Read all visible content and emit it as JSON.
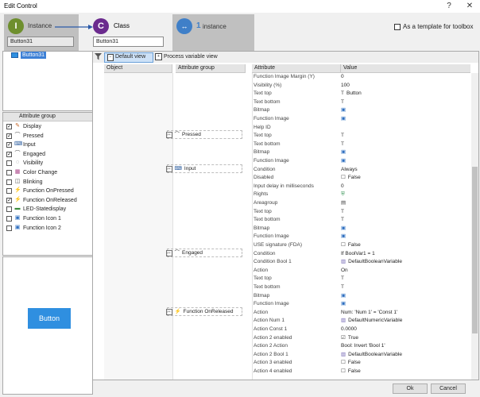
{
  "window": {
    "title": "Edit Control",
    "help": "?",
    "close": "✕"
  },
  "header": {
    "instance_label": "Instance",
    "instance_badge": "I",
    "class_label": "Class",
    "class_badge": "C",
    "count_badge": "1",
    "count_label": "instance",
    "instance_name": "Button31",
    "class_name": "Button31",
    "template_label": "As a template for toolbox"
  },
  "tree": {
    "item": "Button31"
  },
  "toolbar": {
    "default_view": "Default view",
    "process_view": "Process variable view"
  },
  "columns": {
    "object": "Object",
    "attribute_group": "Attribute group",
    "attribute": "Attribute",
    "value": "Value"
  },
  "attr_groups_panel": {
    "header": "Attribute group",
    "items": [
      {
        "label": "Display",
        "checked": true,
        "icon": "pencil-icon"
      },
      {
        "label": "Pressed",
        "checked": true,
        "icon": "wave-icon"
      },
      {
        "label": "Input",
        "checked": true,
        "icon": "input-icon"
      },
      {
        "label": "Engaged",
        "checked": true,
        "icon": "wave-icon"
      },
      {
        "label": "Visibility",
        "checked": false,
        "icon": "eye-icon"
      },
      {
        "label": "Color Change",
        "checked": false,
        "icon": "color-icon"
      },
      {
        "label": "Blinking",
        "checked": false,
        "icon": "blink-icon"
      },
      {
        "label": "Function OnPressed",
        "checked": false,
        "icon": "lightning-icon"
      },
      {
        "label": "Function OnReleased",
        "checked": true,
        "icon": "lightning-icon"
      },
      {
        "label": "LED-Statedisplay",
        "checked": false,
        "icon": "led-icon"
      },
      {
        "label": "Function Icon 1",
        "checked": false,
        "icon": "image-icon"
      },
      {
        "label": "Function Icon 2",
        "checked": false,
        "icon": "image-icon"
      }
    ]
  },
  "preview": {
    "button_label": "Button"
  },
  "groups": [
    {
      "label": "Pressed",
      "icon": "wave-icon"
    },
    {
      "label": "Input",
      "icon": "input-icon"
    },
    {
      "label": "Engaged",
      "icon": "wave-icon"
    },
    {
      "label": "Function OnReleased",
      "icon": "lightning-icon"
    }
  ],
  "properties": [
    {
      "attr": "Function Image Margin (Y)",
      "value": "0",
      "icon": ""
    },
    {
      "attr": "Visibility (%)",
      "value": "100",
      "icon": ""
    },
    {
      "attr": "Text top",
      "value": "Button",
      "icon": "text-icon"
    },
    {
      "attr": "Text bottom",
      "value": "",
      "icon": "text-icon"
    },
    {
      "attr": "Bitmap",
      "value": "",
      "icon": "image-icon"
    },
    {
      "attr": "Function Image",
      "value": "",
      "icon": "image-icon"
    },
    {
      "attr": "Help ID",
      "value": "",
      "icon": ""
    },
    {
      "attr": "Text top",
      "value": "",
      "icon": "text-icon"
    },
    {
      "attr": "Text bottom",
      "value": "",
      "icon": "text-icon"
    },
    {
      "attr": "Bitmap",
      "value": "",
      "icon": "image-icon"
    },
    {
      "attr": "Function Image",
      "value": "",
      "icon": "image-icon"
    },
    {
      "attr": "Condition",
      "value": "Always",
      "icon": ""
    },
    {
      "attr": "Disabled",
      "value": "False",
      "icon": "checkbox-icon"
    },
    {
      "attr": "Input delay in milliseconds",
      "value": "0",
      "icon": ""
    },
    {
      "attr": "Rights",
      "value": "",
      "icon": "shield-icon"
    },
    {
      "attr": "Areagroup",
      "value": "",
      "icon": "grid-icon"
    },
    {
      "attr": "Text top",
      "value": "",
      "icon": "text-icon"
    },
    {
      "attr": "Text bottom",
      "value": "",
      "icon": "text-icon"
    },
    {
      "attr": "Bitmap",
      "value": "",
      "icon": "image-icon"
    },
    {
      "attr": "Function Image",
      "value": "",
      "icon": "image-icon"
    },
    {
      "attr": "USE signature (FDA)",
      "value": "False",
      "icon": "checkbox-icon"
    },
    {
      "attr": "Condition",
      "value": "If BoolVar1 = 1",
      "icon": ""
    },
    {
      "attr": "Condition Bool 1",
      "value": "DefaultBooleanVariable",
      "icon": "variable-icon"
    },
    {
      "attr": "Action",
      "value": "On",
      "icon": ""
    },
    {
      "attr": "Text top",
      "value": "",
      "icon": "text-icon"
    },
    {
      "attr": "Text bottom",
      "value": "",
      "icon": "text-icon"
    },
    {
      "attr": "Bitmap",
      "value": "",
      "icon": "image-icon"
    },
    {
      "attr": "Function Image",
      "value": "",
      "icon": "image-icon"
    },
    {
      "attr": "Action",
      "value": "Num: 'Num 1' = 'Const 1'",
      "icon": ""
    },
    {
      "attr": "Action Num 1",
      "value": "DefaultNumericVariable",
      "icon": "variable-icon"
    },
    {
      "attr": "Action Const 1",
      "value": "0.0000",
      "icon": ""
    },
    {
      "attr": "Action 2 enabled",
      "value": "True",
      "icon": "checked-icon"
    },
    {
      "attr": "Action 2 Action",
      "value": "Bool: Invert 'Bool 1'",
      "icon": ""
    },
    {
      "attr": "Action 2 Bool 1",
      "value": "DefaultBooleanVariable",
      "icon": "variable-icon"
    },
    {
      "attr": "Action 3 enabled",
      "value": "False",
      "icon": "checkbox-icon"
    },
    {
      "attr": "Action 4 enabled",
      "value": "False",
      "icon": "checkbox-icon"
    }
  ],
  "footer": {
    "ok": "Ok",
    "cancel": "Cancel"
  },
  "colors": {
    "instance": "#6e8f2e",
    "class": "#6b2b8e",
    "count": "#3f7fc8",
    "accent_button": "#2f8fe0",
    "selection": "#3d80d6"
  }
}
